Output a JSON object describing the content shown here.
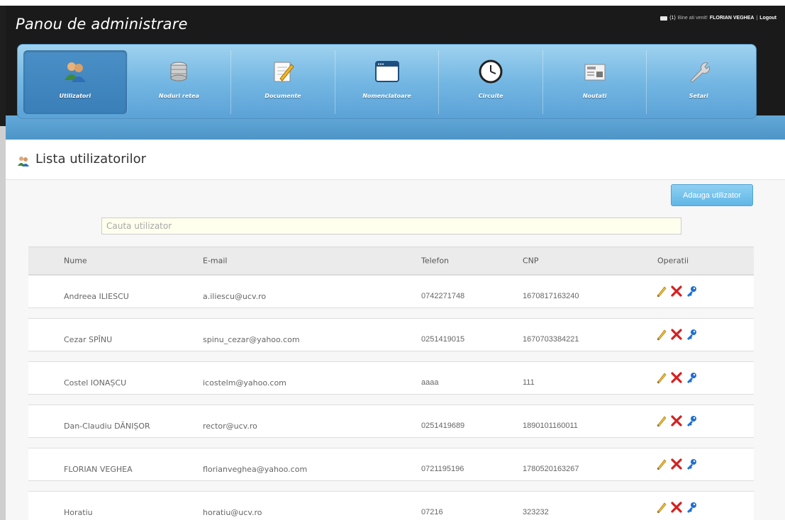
{
  "app": {
    "title": "Panou de administrare"
  },
  "userbar": {
    "count": "(1)",
    "greeting": "Bine ati venit!",
    "user": "FLORIAN VEGHEA",
    "separator": "|",
    "logout": "Logout"
  },
  "nav": [
    {
      "label": "Utilizatori",
      "icon": "users-icon",
      "active": true
    },
    {
      "label": "Noduri retea",
      "icon": "database-icon",
      "active": false
    },
    {
      "label": "Documente",
      "icon": "document-edit-icon",
      "active": false
    },
    {
      "label": "Nomenclatoare",
      "icon": "window-icon",
      "active": false
    },
    {
      "label": "Circuite",
      "icon": "clock-icon",
      "active": false
    },
    {
      "label": "Noutati",
      "icon": "newspaper-icon",
      "active": false
    },
    {
      "label": "Setari",
      "icon": "wrench-icon",
      "active": false
    }
  ],
  "page": {
    "title": "Lista utilizatorilor",
    "icon": "users-icon"
  },
  "actions": {
    "add_user": "Adauga utilizator"
  },
  "search": {
    "placeholder": "Cauta utilizator",
    "value": ""
  },
  "table": {
    "headers": {
      "name": "Nume",
      "email": "E-mail",
      "phone": "Telefon",
      "cnp": "CNP",
      "ops": "Operatii"
    },
    "rows": [
      {
        "name": "Andreea ILIESCU",
        "email": "a.iliescu@ucv.ro",
        "phone": "0742271748",
        "cnp": "1670817163240"
      },
      {
        "name": "Cezar SPÎNU",
        "email": "spinu_cezar@yahoo.com",
        "phone": "0251419015",
        "cnp": "1670703384221"
      },
      {
        "name": "Costel IONAȘCU",
        "email": "icostelm@yahoo.com",
        "phone": "aaaa",
        "cnp": "111"
      },
      {
        "name": "Dan-Claudiu DĂNIȘOR",
        "email": "rector@ucv.ro",
        "phone": "0251419689",
        "cnp": "1890101160011"
      },
      {
        "name": "FLORIAN VEGHEA",
        "email": "florianveghea@yahoo.com",
        "phone": "0721195196",
        "cnp": "1780520163267"
      },
      {
        "name": "Horatiu",
        "email": "horatiu@ucv.ro",
        "phone": "07216",
        "cnp": "323232"
      }
    ],
    "row_operations": [
      "edit-pencil-icon",
      "delete-x-icon",
      "key-icon"
    ]
  },
  "colors": {
    "accent": "#5ba2d6",
    "topbar": "#1a1a1a",
    "delete": "#d42020",
    "key": "#1f6fd0"
  }
}
